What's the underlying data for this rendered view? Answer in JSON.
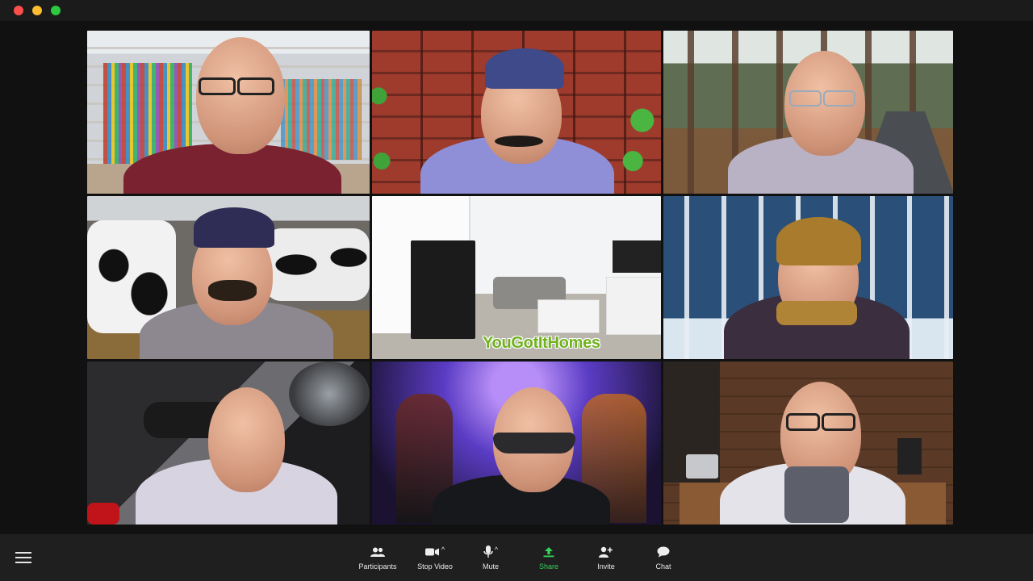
{
  "window": {
    "controls": [
      "close",
      "minimize",
      "zoom"
    ]
  },
  "meeting": {
    "layout": "gallery-3x3",
    "tiles": [
      {
        "name": "library-background",
        "active": false
      },
      {
        "name": "brick-wall-background",
        "active": false
      },
      {
        "name": "forest-road-background",
        "active": false
      },
      {
        "name": "dairy-barn-background",
        "active": false
      },
      {
        "name": "living-room-background",
        "active": false
      },
      {
        "name": "snowy-forest-background",
        "active": false
      },
      {
        "name": "spaceship-background",
        "active": false
      },
      {
        "name": "disco-party-background",
        "active": true
      },
      {
        "name": "bar-cafe-background",
        "active": false
      }
    ],
    "living_room_logo": "YouGotItHomes"
  },
  "toolbar": {
    "participants_label": "Participants",
    "stop_video_label": "Stop Video",
    "mute_label": "Mute",
    "share_label": "Share",
    "invite_label": "Invite",
    "chat_label": "Chat"
  },
  "colors": {
    "active_speaker": "#c2f32b",
    "share_accent": "#35d35a",
    "toolbar_bg": "#1f1f1f"
  }
}
